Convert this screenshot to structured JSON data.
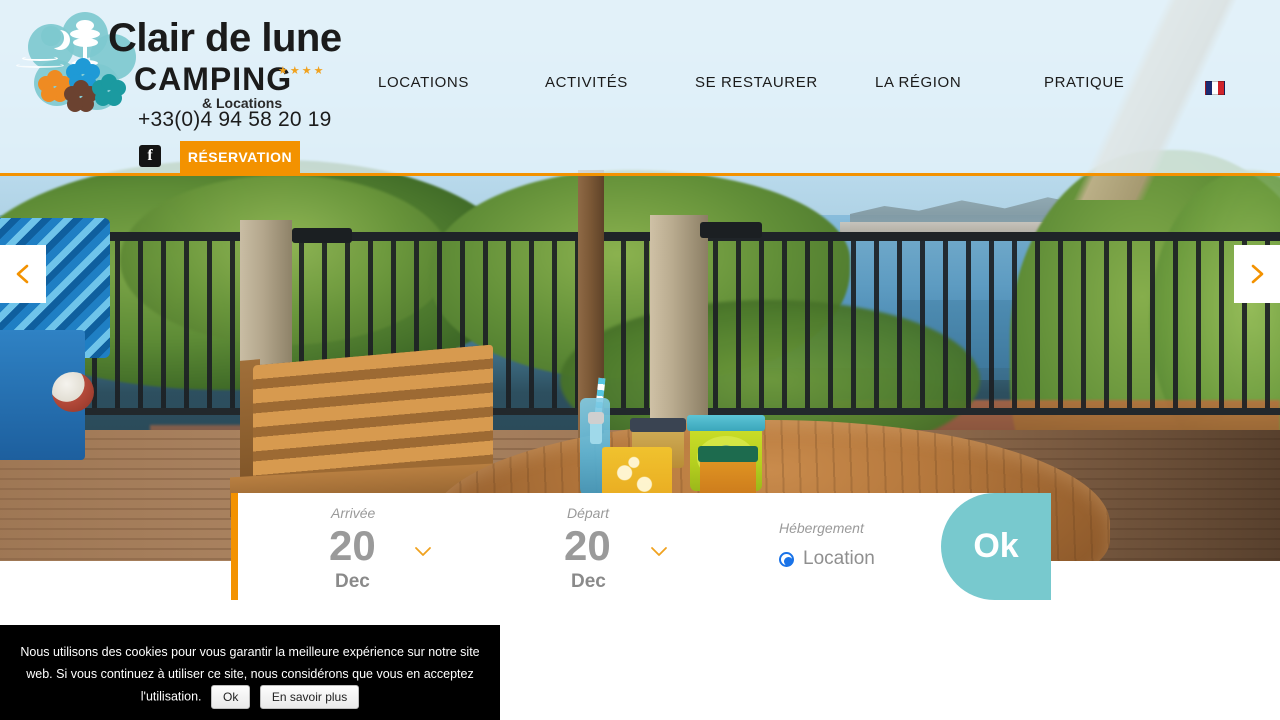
{
  "site": {
    "logo": {
      "line1": "Clair de lune",
      "line2": "CAMPING",
      "stars": "★★★★",
      "line3": "& Locations",
      "icon_names": [
        "moon-icon",
        "pine-tree-icon",
        "hibiscus-flower-icon"
      ]
    },
    "phone": "+33(0)4 94 58 20 19",
    "facebook_label": "f",
    "reservation_button": "RÉSERVATION",
    "language_flag": "fr-flag-icon"
  },
  "nav": {
    "items": [
      {
        "label": "LOCATIONS"
      },
      {
        "label": "ACTIVITÉS"
      },
      {
        "label": "SE RESTAURER"
      },
      {
        "label": "LA RÉGION"
      },
      {
        "label": "PRATIQUE"
      }
    ]
  },
  "slider": {
    "prev_icon": "chevron-left-icon",
    "next_icon": "chevron-right-icon"
  },
  "booking": {
    "arrival": {
      "label": "Arrivée",
      "day": "20",
      "month": "Dec",
      "chevron_icon": "chevron-down-icon"
    },
    "departure": {
      "label": "Départ",
      "day": "20",
      "month": "Dec",
      "chevron_icon": "chevron-down-icon"
    },
    "accommodation": {
      "label": "Hébergement",
      "option": "Location"
    },
    "submit_label": "Ok"
  },
  "cookie": {
    "message": "Nous utilisons des cookies pour vous garantir la meilleure expérience sur notre site web. Si vous continuez à utiliser ce site, nous considérons que vous en acceptez l'utilisation.",
    "accept_label": "Ok",
    "more_label": "En savoir plus"
  },
  "colors": {
    "accent_orange": "#f39200",
    "accent_teal": "#78c9ce",
    "header_bg": "#e5f3fa",
    "radio_blue": "#1a73e8",
    "cookie_bg": "#000000"
  }
}
